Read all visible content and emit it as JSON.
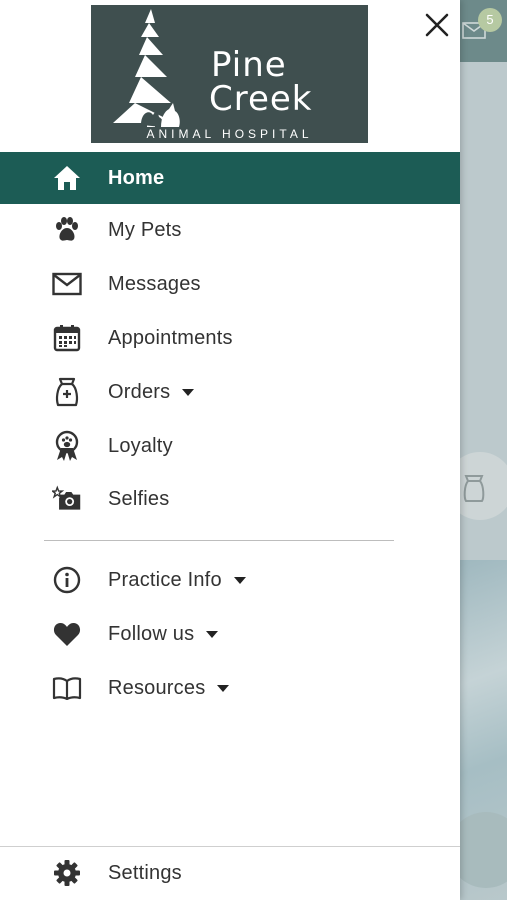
{
  "logo": {
    "line1": "Pine",
    "line2": "Creek",
    "tagline": "ANIMAL HOSPITAL"
  },
  "close": {
    "icon": "close-icon"
  },
  "menu": {
    "items": [
      {
        "label": "Home",
        "icon": "home-icon",
        "active": true
      },
      {
        "label": "My Pets",
        "icon": "paw-icon"
      },
      {
        "label": "Messages",
        "icon": "envelope-icon"
      },
      {
        "label": "Appointments",
        "icon": "calendar-icon"
      },
      {
        "label": "Orders",
        "icon": "pet-food-bag-icon",
        "dropdown": true
      },
      {
        "label": "Loyalty",
        "icon": "award-ribbon-icon"
      },
      {
        "label": "Selfies",
        "icon": "camera-star-icon"
      }
    ],
    "secondary": [
      {
        "label": "Practice Info",
        "icon": "info-icon",
        "dropdown": true
      },
      {
        "label": "Follow us",
        "icon": "heart-icon",
        "dropdown": true
      },
      {
        "label": "Resources",
        "icon": "book-icon",
        "dropdown": true
      }
    ],
    "footer": {
      "label": "Settings",
      "icon": "gear-icon"
    }
  },
  "background": {
    "mail_badge_count": "5"
  },
  "colors": {
    "active_bg": "#1c5c55",
    "logo_bg": "#3f4f4f",
    "text": "#333333"
  }
}
